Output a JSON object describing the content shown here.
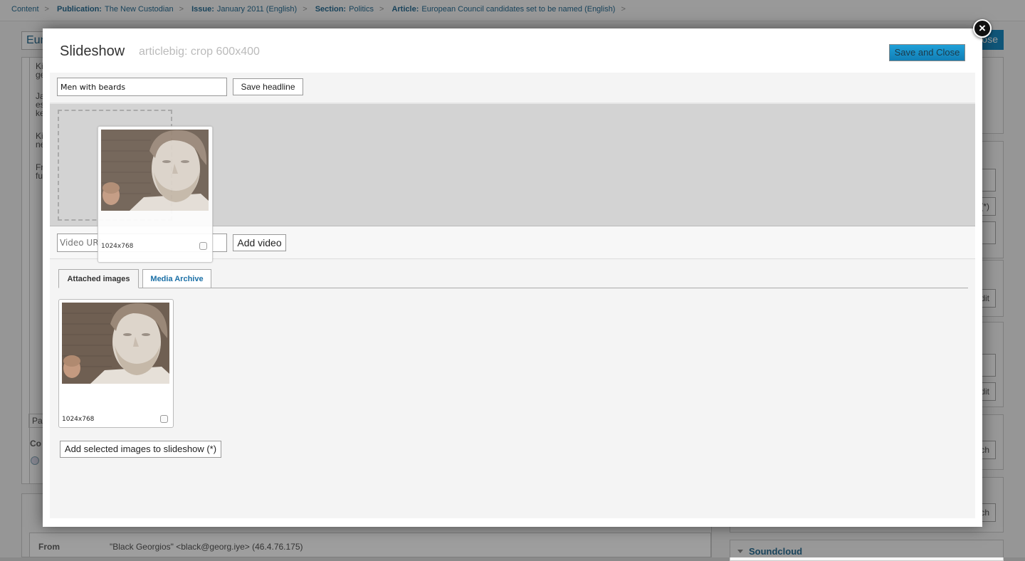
{
  "background": {
    "breadcrumb": [
      {
        "label": "",
        "value": "Content"
      },
      {
        "label": "Publication:",
        "value": "The New Custodian"
      },
      {
        "label": "Issue:",
        "value": "January 2011 (English)"
      },
      {
        "label": "Section:",
        "value": "Politics"
      },
      {
        "label": "Article:",
        "value": "European Council candidates set to be named (English)"
      }
    ],
    "article_title_fragment": "Eur",
    "save_button_fragment": "ose",
    "text_fragments": [
      "Ki",
      "ge",
      "Ja",
      "es",
      "ke",
      "Ki",
      "ne",
      "Fr",
      "fu"
    ],
    "path_fragment": "Pa",
    "comment_fragment": "Co",
    "from_label": "From",
    "from_value": "\"Black Georgios\" <black@georg.iye> (46.4.76.175)",
    "right_buttons": [
      "(*)",
      "dit",
      "dit",
      "ch",
      "ch"
    ],
    "soundcloud_label": "Soundcloud"
  },
  "modal": {
    "title": "Slideshow",
    "subtitle": "articlebig: crop 600x400",
    "save_and_close_label": "Save and Close",
    "close_icon": "×",
    "headline_value": "Men with beards",
    "save_headline_label": "Save headline",
    "video_url_placeholder": "Video URL",
    "add_video_label": "Add video",
    "tabs": [
      {
        "label": "Attached images",
        "active": true
      },
      {
        "label": "Media Archive",
        "active": false
      }
    ],
    "dragging_image": {
      "dimensions": "1024x768",
      "checked": false
    },
    "attached_images": [
      {
        "dimensions": "1024x768",
        "checked": false
      }
    ],
    "add_selected_label": "Add selected images to slideshow (*)"
  },
  "colors": {
    "accent": "#1a8bc4",
    "link": "#1a6fa6"
  }
}
